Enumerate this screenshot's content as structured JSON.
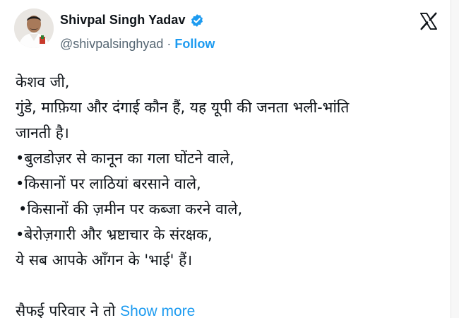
{
  "tweet": {
    "author": {
      "display_name": "Shivpal Singh Yadav",
      "handle": "@shivpalsinghyad",
      "separator": "·",
      "follow_label": "Follow",
      "verified_icon": "verified-badge-icon",
      "avatar_icon": "profile-photo"
    },
    "platform_icon": "x-logo-icon",
    "lines": [
      "केशव जी,",
      "गुंडे, माफ़िया और दंगाई कौन हैं, यह यूपी की जनता भली-भांति",
      "जानती है।",
      "•बुलडोज़र से कानून का गला घोंटने वाले,",
      "•किसानों पर लाठियां बरसाने वाले,",
      "•किसानों की ज़मीन पर कब्जा करने वाले,",
      "•बेरोज़गारी और भ्रष्टाचार के संरक्षक,",
      "ये सब आपके आँगन के 'भाई' हैं।",
      "",
      "सैफई परिवार ने तो"
    ],
    "show_more_label": "Show more",
    "colors": {
      "accent": "#1d9bf0",
      "text": "#0f1419",
      "muted": "#536471"
    }
  }
}
